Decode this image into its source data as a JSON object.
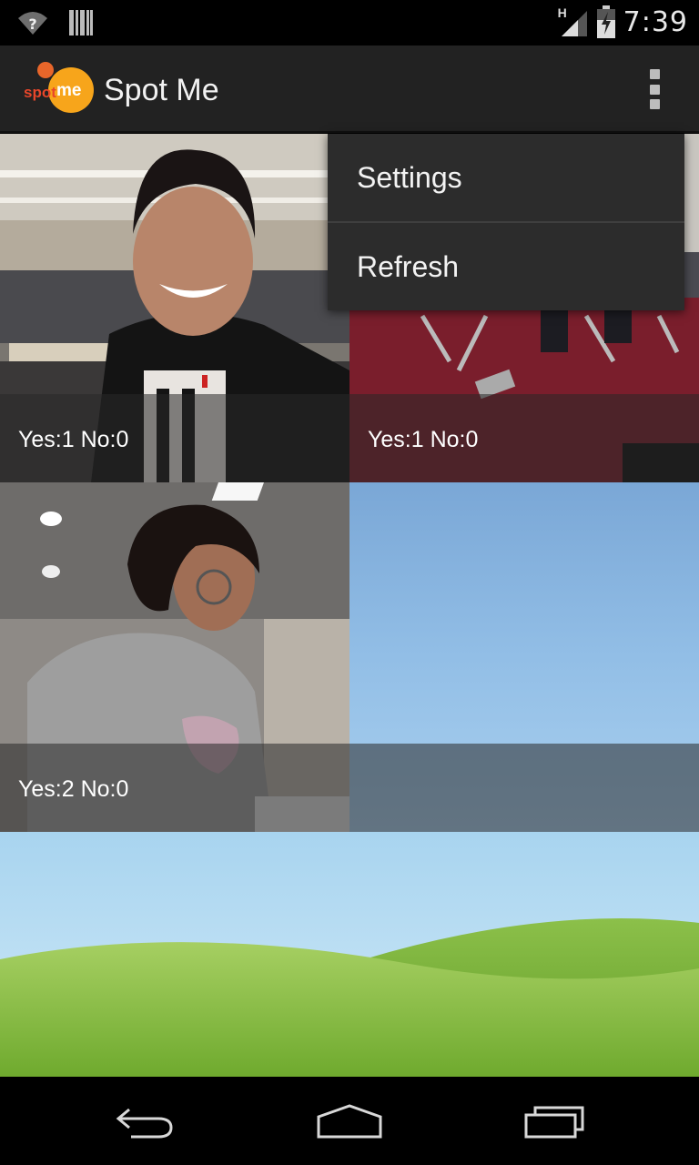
{
  "status_bar": {
    "time": "7:39",
    "network_type": "H",
    "icons": [
      "wifi-unknown-icon",
      "barcode-notification-icon",
      "signal-icon",
      "battery-charging-icon"
    ]
  },
  "action_bar": {
    "logo_text_1": "spot",
    "logo_text_2": "me",
    "title": "Spot Me",
    "overflow_icon": "overflow-menu-icon"
  },
  "menu": {
    "items": [
      {
        "label": "Settings"
      },
      {
        "label": "Refresh"
      }
    ]
  },
  "grid": {
    "tiles": [
      {
        "caption": "Yes:1 No:0"
      },
      {
        "caption": "Yes:1 No:0"
      },
      {
        "caption": "Yes:2 No:0"
      },
      {
        "caption": ""
      },
      {
        "caption": ""
      }
    ]
  },
  "nav_bar": {
    "icons": [
      "back-icon",
      "home-icon",
      "recent-apps-icon"
    ]
  },
  "colors": {
    "action_bar": "#222222",
    "logo_orange": "#f7a51b",
    "logo_red": "#e8462a",
    "menu_bg": "#2c2c2c",
    "sky": "#a9d4ef",
    "grass": "#7fb33a"
  }
}
